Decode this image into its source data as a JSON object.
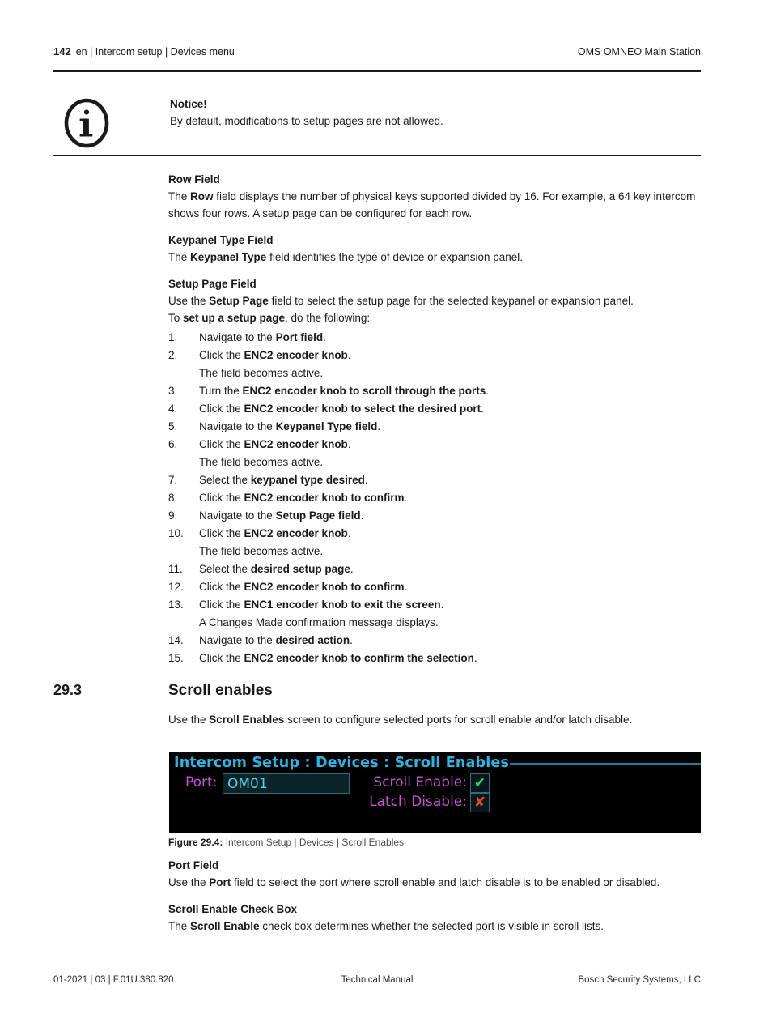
{
  "header": {
    "page_number": "142",
    "breadcrumb": "en | Intercom setup | Devices menu",
    "product": "OMS OMNEO Main Station"
  },
  "notice": {
    "icon": "info-circle-icon",
    "title": "Notice!",
    "text": "By default, modifications to setup pages are not allowed."
  },
  "sections": {
    "row_field": {
      "heading": "Row Field",
      "paragraph_pre": "The ",
      "paragraph_bold": "Row",
      "paragraph_post": " field displays the number of physical keys supported divided by 16. For example, a 64 key intercom shows four rows. A setup page can be configured for each row."
    },
    "keypanel_type_field": {
      "heading": "Keypanel Type Field",
      "paragraph_pre": "The ",
      "paragraph_bold": "Keypanel Type",
      "paragraph_post": " field identifies the type of device or expansion panel."
    },
    "setup_page_field": {
      "heading": "Setup Page Field",
      "paragraph_pre": "Use the ",
      "paragraph_bold": "Setup Page",
      "paragraph_post": " field to select the setup page for the selected keypanel or expansion panel.",
      "intro_pre": "To ",
      "intro_bold": "set up a setup page",
      "intro_post": ", do the following:"
    }
  },
  "steps": [
    {
      "num": "1.",
      "pre": "Navigate to the ",
      "bold": "Port field",
      "post": "."
    },
    {
      "num": "2.",
      "pre": "Click the ",
      "bold": "ENC2 encoder knob",
      "post": ".",
      "note": "The field becomes active."
    },
    {
      "num": "3.",
      "pre": "Turn the ",
      "bold": "ENC2 encoder knob to scroll through the ports",
      "post": "."
    },
    {
      "num": "4.",
      "pre": "Click the ",
      "bold": "ENC2 encoder knob to select the desired port",
      "post": "."
    },
    {
      "num": "5.",
      "pre": "Navigate to the ",
      "bold": "Keypanel Type field",
      "post": "."
    },
    {
      "num": "6.",
      "pre": "Click the ",
      "bold": "ENC2 encoder knob",
      "post": ".",
      "note": "The field becomes active."
    },
    {
      "num": "7.",
      "pre": "Select the ",
      "bold": "keypanel type desired",
      "post": "."
    },
    {
      "num": "8.",
      "pre": "Click the ",
      "bold": "ENC2 encoder knob to confirm",
      "post": "."
    },
    {
      "num": "9.",
      "pre": "Navigate to the ",
      "bold": "Setup Page field",
      "post": "."
    },
    {
      "num": "10.",
      "pre": "Click the ",
      "bold": "ENC2 encoder knob",
      "post": ".",
      "note": "The field becomes active."
    },
    {
      "num": "11.",
      "pre": "Select the ",
      "bold": "desired setup page",
      "post": "."
    },
    {
      "num": "12.",
      "pre": "Click the ",
      "bold": "ENC2 encoder knob to confirm",
      "post": "."
    },
    {
      "num": "13.",
      "pre": "Click the ",
      "bold": "ENC1 encoder knob to exit the screen",
      "post": ".",
      "note": "A Changes Made confirmation message displays."
    },
    {
      "num": "14.",
      "pre": "Navigate to the ",
      "bold": "desired action",
      "post": "."
    },
    {
      "num": "15.",
      "pre": "Click the ",
      "bold": "ENC2 encoder knob to confirm the selection",
      "post": "."
    }
  ],
  "scroll_enables": {
    "section_number": "29.3",
    "section_title": "Scroll enables",
    "intro_pre": "Use the ",
    "intro_bold": "Scroll Enables",
    "intro_post": " screen to configure selected ports for scroll enable and/or latch disable."
  },
  "lcd": {
    "title": "Intercom Setup : Devices : Scroll Enables",
    "port_label": "Port:",
    "port_value": "OM01",
    "scroll_enable_label": "Scroll Enable:",
    "scroll_enable_mark": "✔",
    "latch_disable_label": "Latch Disable:",
    "latch_disable_mark": "✘",
    "colors": {
      "background": "#000000",
      "title": "#29b6e8",
      "title_rule": "#1d7f9e",
      "label": "#cc4fd6",
      "value": "#4fd6e8",
      "field_fill": "#0a2429",
      "field_border": "#2c6e7a",
      "check": "#18e07e",
      "cross": "#e8472c"
    }
  },
  "figure": {
    "label": "Figure 29.4:",
    "caption": "Intercom Setup | Devices | Scroll Enables"
  },
  "port_field": {
    "heading": "Port Field",
    "paragraph_pre": "Use the ",
    "paragraph_bold": "Port",
    "paragraph_post": " field to select the port where scroll enable and latch disable is to be enabled or disabled."
  },
  "scroll_enable_checkbox": {
    "heading": "Scroll Enable Check Box",
    "paragraph_pre": "The ",
    "paragraph_bold": "Scroll Enable",
    "paragraph_post": " check box determines whether the selected port is visible in scroll lists."
  },
  "footer": {
    "left": "01-2021 | 03 | F.01U.380.820",
    "center": "Technical Manual",
    "right": "Bosch Security Systems, LLC"
  }
}
